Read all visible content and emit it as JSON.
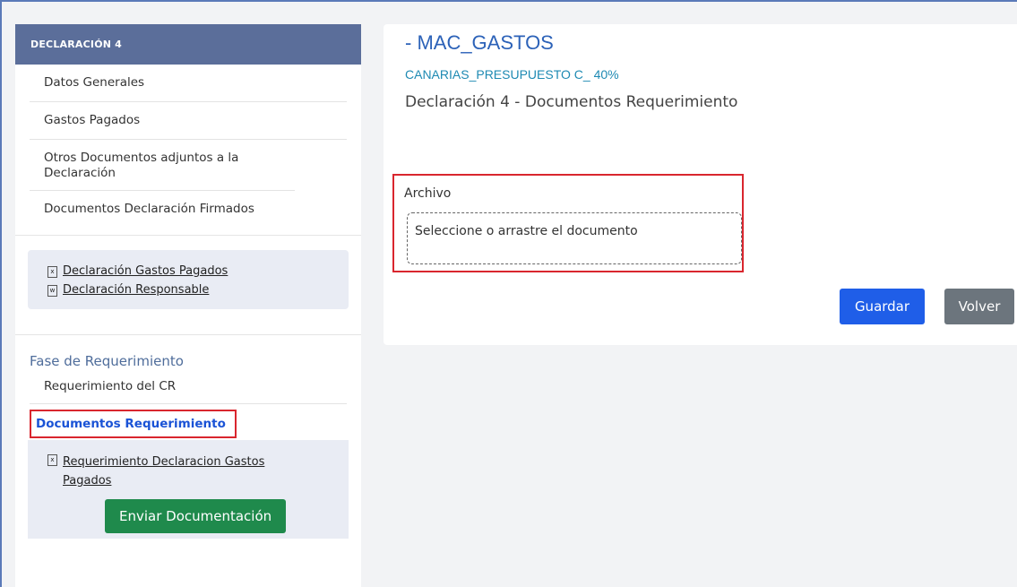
{
  "sidebar": {
    "header": "DECLARACIÓN 4",
    "items": [
      {
        "label": "Datos Generales"
      },
      {
        "label": "Gastos Pagados"
      },
      {
        "label": "Otros Documentos adjuntos a la Declaración"
      },
      {
        "label": "Documentos Declaración Firmados"
      }
    ],
    "documents": [
      {
        "icon": "x",
        "label": "Declaración Gastos Pagados "
      },
      {
        "icon": "w",
        "label": "Declaración Responsable "
      }
    ],
    "phase_title": "Fase de Requerimiento",
    "phase_items": [
      {
        "label": "Requerimiento del CR"
      },
      {
        "label": "Documentos Requerimiento"
      }
    ],
    "req_documents": [
      {
        "icon": "x",
        "label": "Requerimiento Declaracion Gastos Pagados "
      }
    ],
    "send_button": "Enviar Documentación"
  },
  "main": {
    "title": "- MAC_GASTOS",
    "subtitle": "CANARIAS_PRESUPUESTO C_ 40%",
    "section": "Declaración 4 - Documentos Requerimiento",
    "file_label": "Archivo",
    "dropzone_text": "Seleccione o arrastre el documento",
    "save_button": "Guardar",
    "back_button": "Volver"
  },
  "colors": {
    "header_bg": "#5b6e9a",
    "active_link": "#1a53d6",
    "highlight_border": "#d9262e",
    "primary_button": "#1f5ee8",
    "success_button": "#1f8a4c",
    "secondary_button": "#6c757d"
  }
}
